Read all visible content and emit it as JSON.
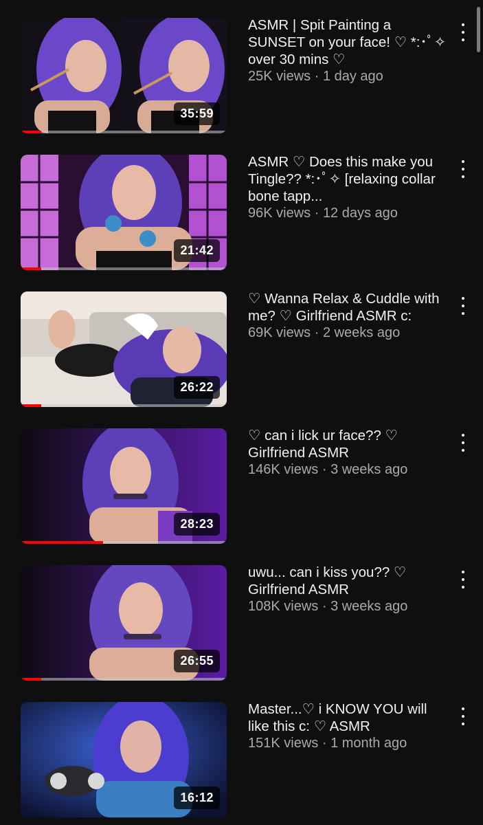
{
  "videos": [
    {
      "title": "ASMR | Spit Painting a SUNSET on your face! ♡ *:･ﾟ✧ over 30 mins ♡",
      "views": "25K views",
      "age": "1 day ago",
      "duration": "35:59",
      "watched_fraction": 0.1
    },
    {
      "title": "ASMR ♡ Does this make you Tingle?? *:･ﾟ✧ [relaxing collar bone tapp...",
      "views": "96K views",
      "age": "12 days ago",
      "duration": "21:42",
      "watched_fraction": 0.1
    },
    {
      "title": "♡ Wanna Relax & Cuddle with me? ♡ Girlfriend ASMR c:",
      "views": "69K views",
      "age": "2 weeks ago",
      "duration": "26:22",
      "watched_fraction": 0.1
    },
    {
      "title": "♡ can i lick ur face?? ♡ Girlfriend ASMR",
      "views": "146K views",
      "age": "3 weeks ago",
      "duration": "28:23",
      "watched_fraction": 0.4
    },
    {
      "title": "uwu... can i kiss you?? ♡ Girlfriend ASMR",
      "views": "108K views",
      "age": "3 weeks ago",
      "duration": "26:55",
      "watched_fraction": 0.1
    },
    {
      "title": "Master...♡ i KNOW YOU will like this c: ♡ ASMR",
      "views": "151K views",
      "age": "1 month ago",
      "duration": "16:12",
      "watched_fraction": 0
    }
  ],
  "separator": " · ",
  "icons": {
    "menu": "more-vertical-icon"
  },
  "colors": {
    "background": "#0f0f0f",
    "progress": "#ff0000",
    "title": "#f1f1f1",
    "secondary": "#aaaaaa"
  }
}
